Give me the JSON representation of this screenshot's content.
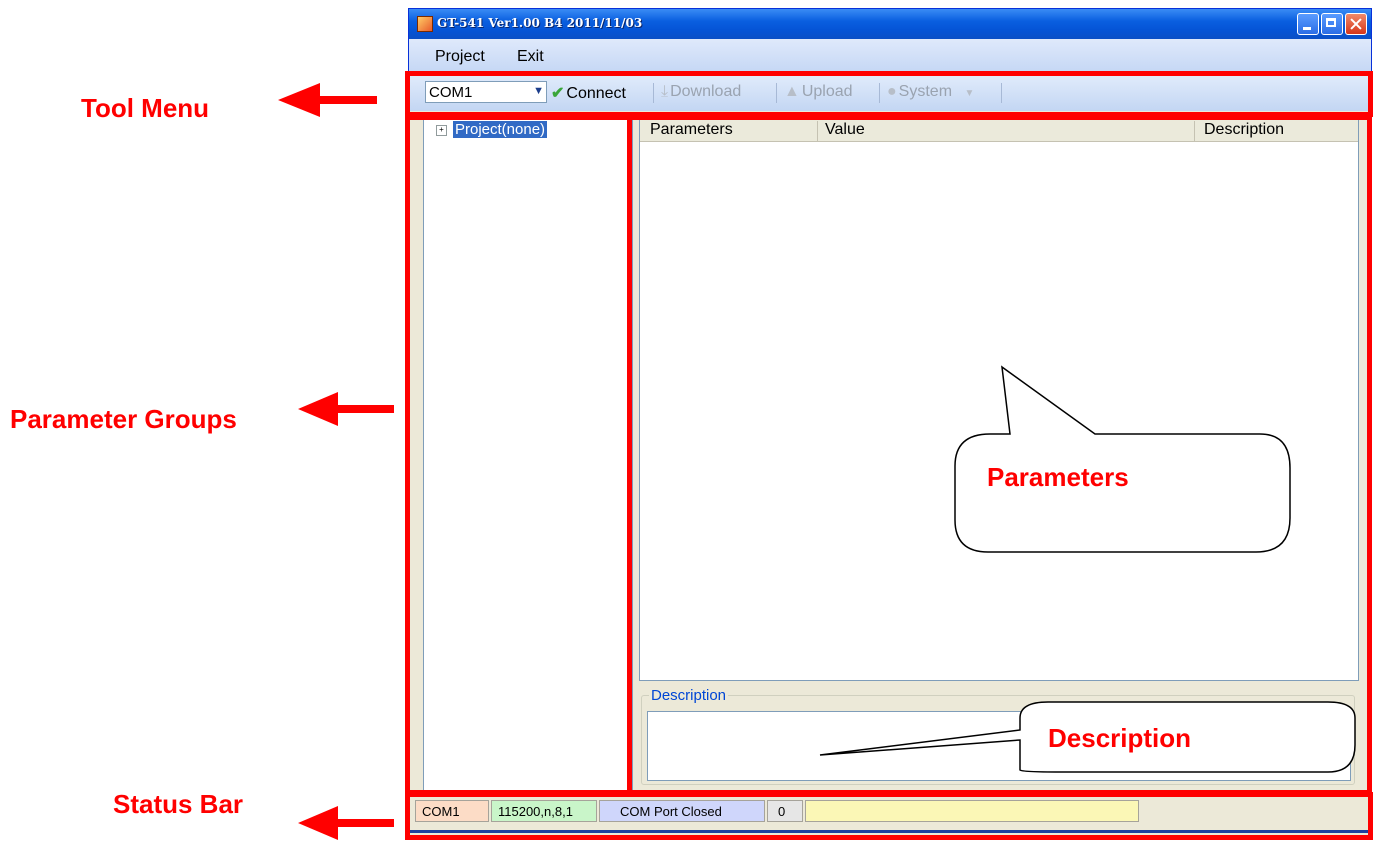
{
  "window": {
    "title": "GT-541 Ver1.00 B4 2011/11/03"
  },
  "menu": {
    "items": [
      "Project",
      "Exit"
    ]
  },
  "toolbar": {
    "port_value": "COM1",
    "connect_label": "Connect",
    "download_label": "Download",
    "upload_label": "Upload",
    "system_label": "System"
  },
  "tree": {
    "root_label": "Project(none)"
  },
  "grid": {
    "columns": [
      "Parameters",
      "Value",
      "Description"
    ]
  },
  "description": {
    "legend": "Description"
  },
  "status_bar": {
    "port": "COM1",
    "baud": "115200,n,8,1",
    "state": "COM Port Closed",
    "count": "0",
    "message": ""
  },
  "annotations": {
    "tool_menu": "Tool  Menu",
    "parameter_groups": "Parameter  Groups",
    "status_bar": "Status  Bar",
    "parameters": "Parameters",
    "description": "Description"
  },
  "colors": {
    "annotation": "#ff0000",
    "titlebar": "#0a5fe0",
    "selection": "#316ac5"
  }
}
